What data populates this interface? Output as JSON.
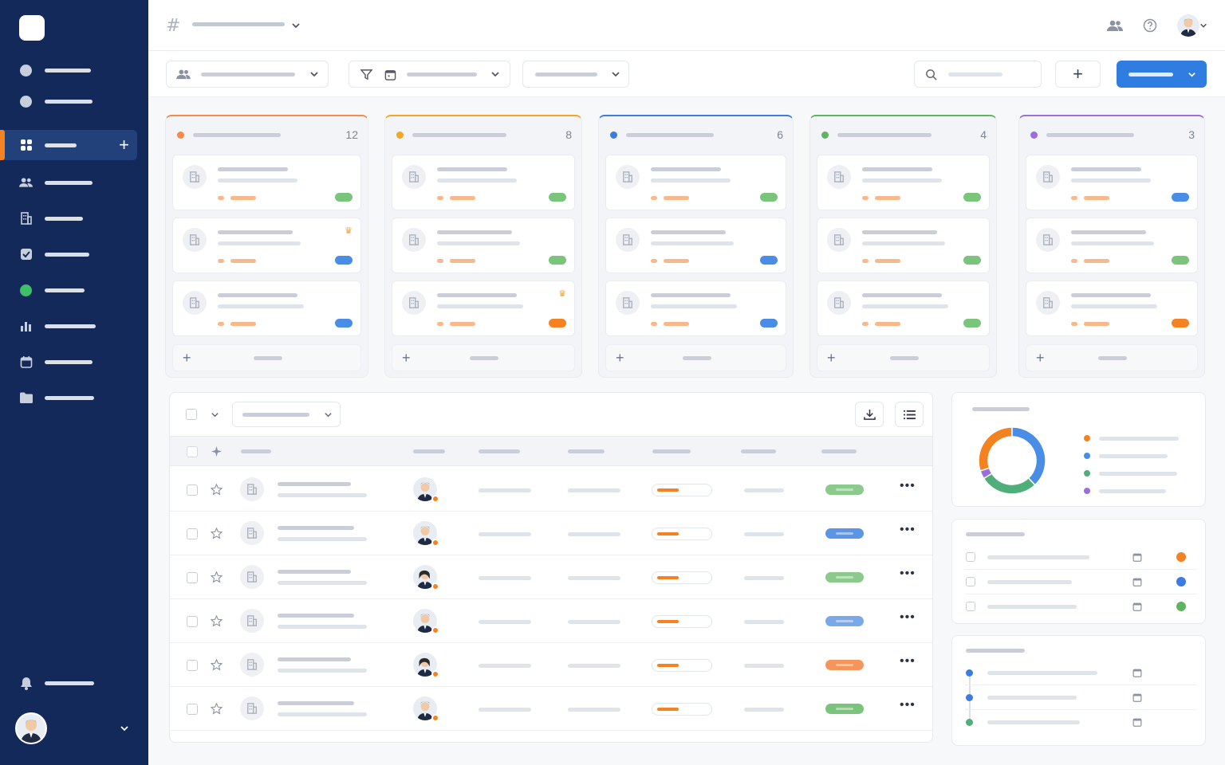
{
  "topbar": {
    "hash_icon": "#"
  },
  "kanban": {
    "columns": [
      {
        "count": "12",
        "color": "#f58a4b"
      },
      {
        "count": "8",
        "color": "#f5a623"
      },
      {
        "count": "6",
        "color": "#3d7be3"
      },
      {
        "count": "4",
        "color": "#5fb55f"
      },
      {
        "count": "3",
        "color": "#9b6ee0"
      }
    ]
  },
  "colors": {
    "sidebar_bg": "#13295a",
    "accent_orange": "#f58220",
    "primary_blue": "#2f7de1",
    "green_tag": "#7bc47b",
    "blue_tag": "#4a8de6",
    "orange_tag": "#f58220"
  },
  "donut": {
    "segments": [
      {
        "color": "#f58220",
        "fraction": 0.3
      },
      {
        "color": "#4a8de6",
        "fraction": 0.38
      },
      {
        "color": "#4fae7a",
        "fraction": 0.28
      },
      {
        "color": "#9b6ee0",
        "fraction": 0.04
      }
    ]
  },
  "table": {
    "rows": [
      {
        "progress": 0.45,
        "tag_color": "#8cc98c"
      },
      {
        "progress": 0.45,
        "tag_color": "#5b95e6"
      },
      {
        "progress": 0.45,
        "tag_color": "#8cc98c"
      },
      {
        "progress": 0.45,
        "tag_color": "#7aa9ea"
      },
      {
        "progress": 0.45,
        "tag_color": "#f5955b"
      },
      {
        "progress": 0.45,
        "tag_color": "#7bc47b"
      }
    ]
  }
}
